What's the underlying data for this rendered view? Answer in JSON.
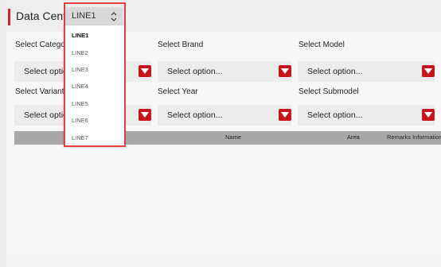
{
  "header": {
    "title": "Data Center"
  },
  "line_select": {
    "value": "LINE1",
    "options": [
      "LINE1",
      "LINE2",
      "LINE3",
      "LINE4",
      "LINE5",
      "LINE6",
      "LINE7"
    ]
  },
  "filters": {
    "row1": [
      {
        "label": "Select Category",
        "placeholder": "Select option"
      },
      {
        "label": "Select Brand",
        "placeholder": "Select option..."
      },
      {
        "label": "Select Model",
        "placeholder": "Select option..."
      }
    ],
    "row2": [
      {
        "label": "Select Variant",
        "placeholder": "Select option"
      },
      {
        "label": "Select Year",
        "placeholder": "Select option..."
      },
      {
        "label": "Select Submodel",
        "placeholder": "Select option..."
      }
    ]
  },
  "table": {
    "columns": [
      "Name",
      "Area",
      "Remarks Information"
    ]
  },
  "colors": {
    "accent": "#c4161c",
    "highlight": "#e0413c"
  }
}
